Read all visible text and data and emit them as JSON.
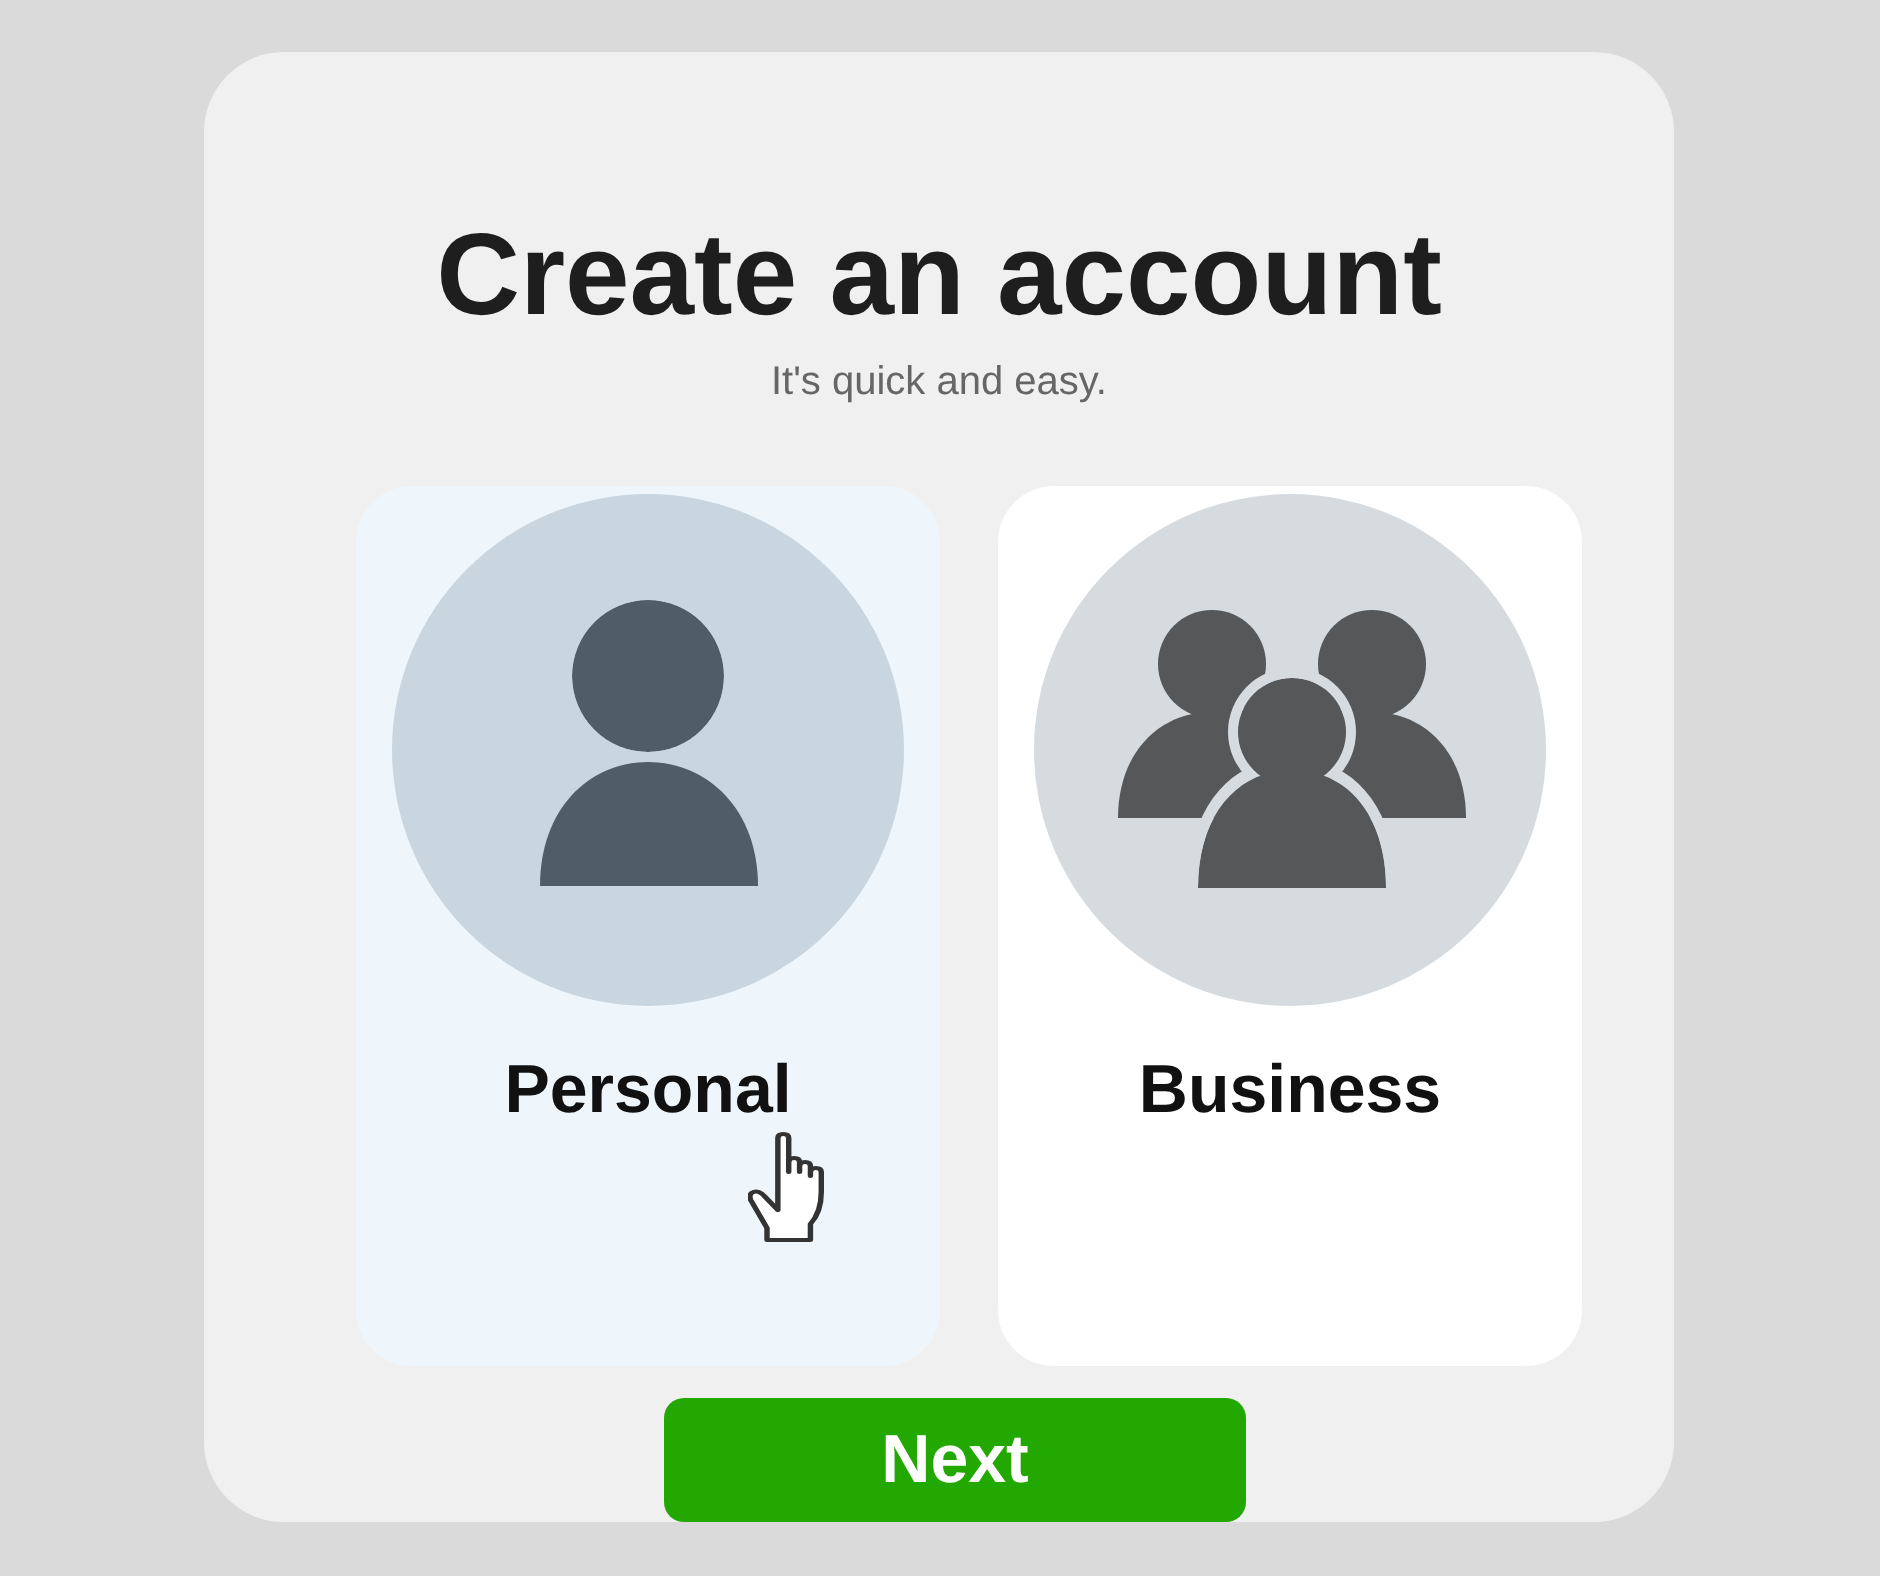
{
  "title": "Create an account",
  "subtitle": "It's quick and easy.",
  "options": [
    {
      "label": "Personal",
      "kind": "person",
      "selected": true
    },
    {
      "label": "Business",
      "kind": "group",
      "selected": false
    }
  ],
  "next_button": {
    "label": "Next"
  }
}
